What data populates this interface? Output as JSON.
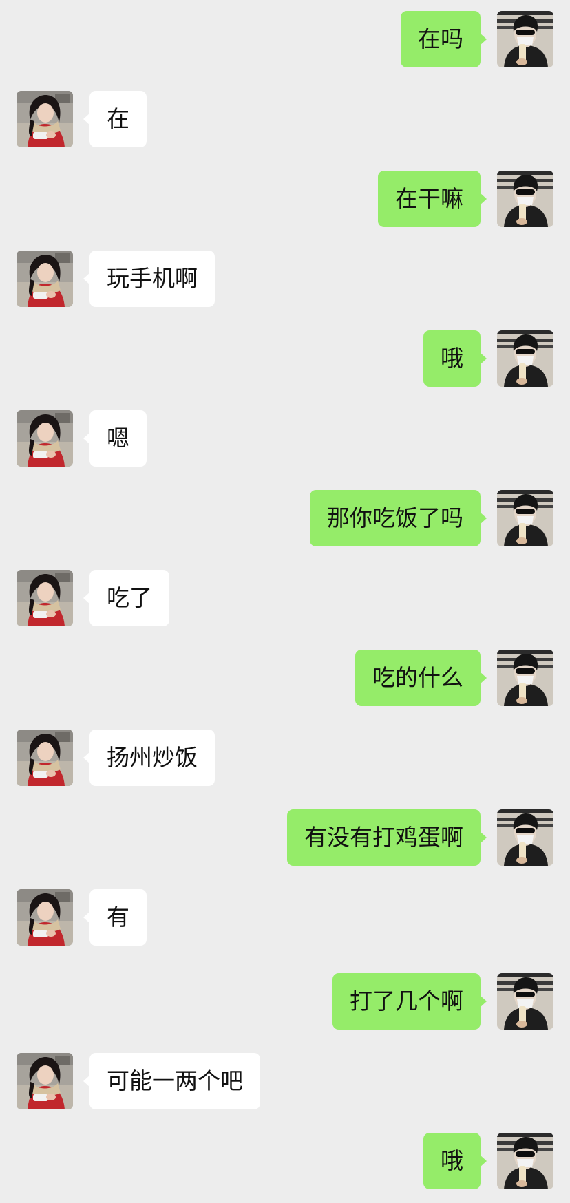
{
  "colors": {
    "background": "#ededed",
    "self_bubble": "#95ec69",
    "other_bubble": "#ffffff"
  },
  "messages": [
    {
      "sender": "self",
      "text": "在吗",
      "avatar": "man-sunglasses-mask-avatar"
    },
    {
      "sender": "other",
      "text": "在",
      "avatar": "woman-red-coat-avatar"
    },
    {
      "sender": "self",
      "text": "在干嘛",
      "avatar": "man-sunglasses-mask-avatar"
    },
    {
      "sender": "other",
      "text": "玩手机啊",
      "avatar": "woman-red-coat-avatar"
    },
    {
      "sender": "self",
      "text": "哦",
      "avatar": "man-sunglasses-mask-avatar"
    },
    {
      "sender": "other",
      "text": "嗯",
      "avatar": "woman-red-coat-avatar"
    },
    {
      "sender": "self",
      "text": "那你吃饭了吗",
      "avatar": "man-sunglasses-mask-avatar"
    },
    {
      "sender": "other",
      "text": "吃了",
      "avatar": "woman-red-coat-avatar"
    },
    {
      "sender": "self",
      "text": "吃的什么",
      "avatar": "man-sunglasses-mask-avatar"
    },
    {
      "sender": "other",
      "text": "扬州炒饭",
      "avatar": "woman-red-coat-avatar"
    },
    {
      "sender": "self",
      "text": "有没有打鸡蛋啊",
      "avatar": "man-sunglasses-mask-avatar"
    },
    {
      "sender": "other",
      "text": "有",
      "avatar": "woman-red-coat-avatar"
    },
    {
      "sender": "self",
      "text": "打了几个啊",
      "avatar": "man-sunglasses-mask-avatar"
    },
    {
      "sender": "other",
      "text": "可能一两个吧",
      "avatar": "woman-red-coat-avatar"
    },
    {
      "sender": "self",
      "text": "哦",
      "avatar": "man-sunglasses-mask-avatar"
    }
  ]
}
